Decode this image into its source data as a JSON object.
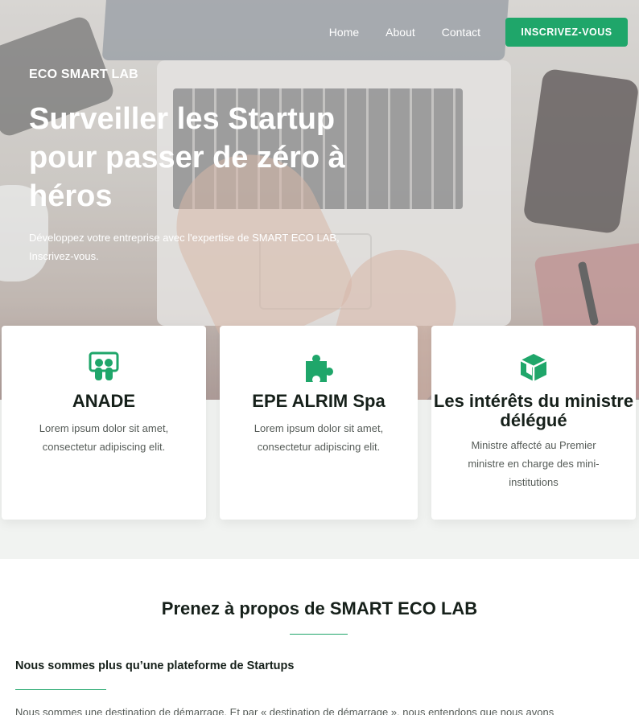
{
  "nav": {
    "links": [
      "Home",
      "About",
      "Contact"
    ],
    "cta_label": "INSCRIVEZ-VOUS"
  },
  "hero": {
    "brand": "ECO SMART LAB",
    "title": "Surveiller les Startup pour passer de zéro à héros",
    "subtitle": "Développez votre entreprise avec l'expertise de SMART ECO LAB, Inscrivez-vous."
  },
  "cards": [
    {
      "icon": "slideshare-icon",
      "title": "ANADE",
      "text": "Lorem ipsum dolor sit amet, consectetur adipiscing elit."
    },
    {
      "icon": "puzzle-icon",
      "title": "EPE ALRIM Spa",
      "text": "Lorem ipsum dolor sit amet, consectetur adipiscing elit."
    },
    {
      "icon": "cube-icon",
      "title": "Les intérêts du ministre délégué",
      "text": "Ministre affecté au Premier ministre en charge des mini-institutions"
    }
  ],
  "about": {
    "title": "Prenez à propos de SMART ECO LAB",
    "subheading": "Nous sommes plus qu’une plateforme de Startups",
    "paragraph": "Nous sommes une destination de démarrage. Et par « destination de démarrage », nous entendons que nous avons"
  },
  "colors": {
    "accent": "#1fa66a",
    "heading": "#16201a",
    "band": "#f1f3f1"
  }
}
